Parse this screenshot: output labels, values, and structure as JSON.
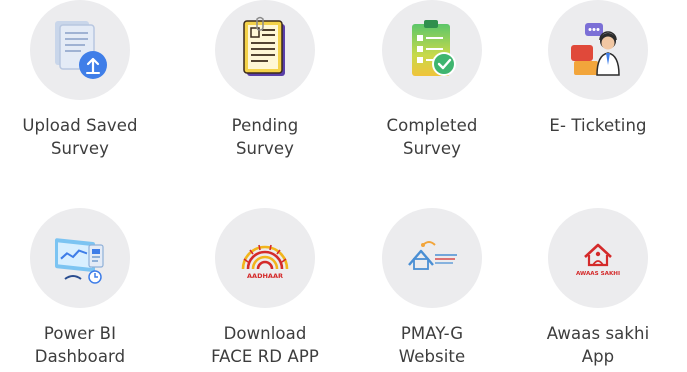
{
  "tiles": [
    {
      "icon": "upload-document-icon",
      "line1": "Upload Saved",
      "line2": "Survey"
    },
    {
      "icon": "pending-clipboard-icon",
      "line1": "Pending",
      "line2": "Survey"
    },
    {
      "icon": "completed-clipboard-icon",
      "line1": "Completed",
      "line2": "Survey"
    },
    {
      "icon": "support-agent-icon",
      "line1": "E- Ticketing",
      "line2": ""
    },
    {
      "icon": "dashboard-icon",
      "line1": "Power BI",
      "line2": "Dashboard"
    },
    {
      "icon": "aadhaar-logo-icon",
      "line1": "Download",
      "line2": "FACE RD APP",
      "logo_text": "AADHAAR"
    },
    {
      "icon": "pmay-g-logo-icon",
      "line1": "PMAY-G",
      "line2": "Website"
    },
    {
      "icon": "awaas-sakhi-logo-icon",
      "line1": "Awaas sakhi",
      "line2": "App",
      "logo_text": "AWAAS SAKHI"
    }
  ],
  "colors": {
    "circle_bg": "#ececee",
    "label_text": "#3d3d3d",
    "accent_blue": "#3f7ee8",
    "success_green": "#3fb56f",
    "aadhaar_red": "#d42a2a",
    "aadhaar_yellow": "#f2b51c"
  }
}
